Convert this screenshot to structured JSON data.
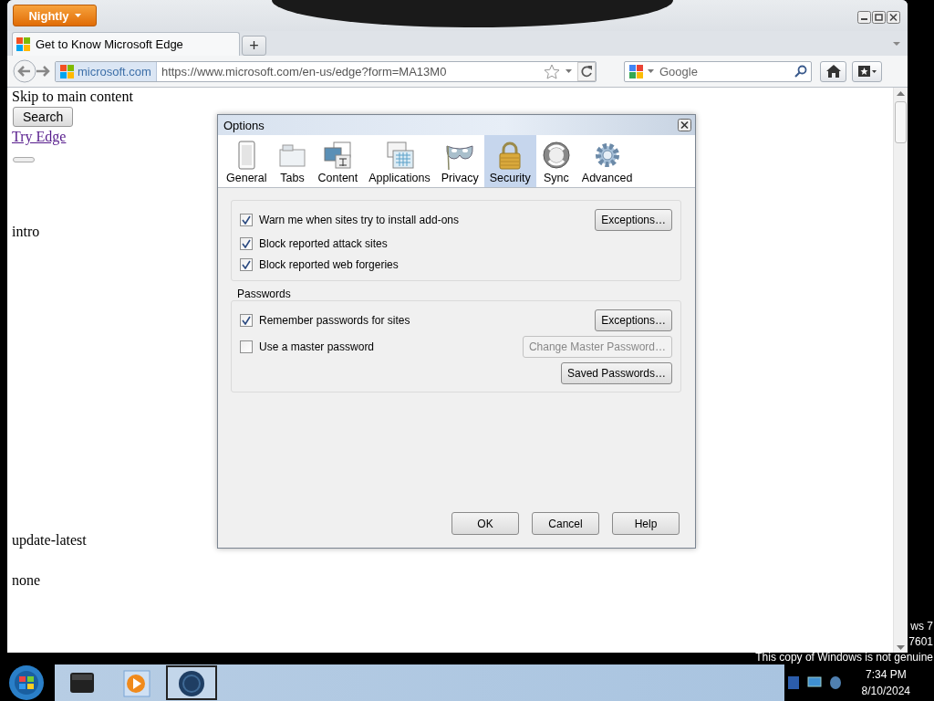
{
  "app_button": {
    "label": "Nightly"
  },
  "tabs": [
    {
      "title": "Get to Know Microsoft Edge",
      "selected": true
    }
  ],
  "new_tab_button": {
    "label": "+"
  },
  "url_bar": {
    "site_identity": "microsoft.com",
    "url": "https://www.microsoft.com/en-us/edge?form=MA13M0"
  },
  "search_bar": {
    "placeholder": "Google"
  },
  "page": {
    "items": [
      {
        "kind": "text",
        "text": "Skip to main content"
      },
      {
        "kind": "button",
        "text": "Search"
      },
      {
        "kind": "link",
        "text": "Try Edge"
      },
      {
        "kind": "slider"
      },
      {
        "kind": "text",
        "text": "intro"
      },
      {
        "kind": "text",
        "text": "update-latest"
      },
      {
        "kind": "text",
        "text": "none"
      }
    ]
  },
  "dialog": {
    "title": "Options",
    "panes": [
      {
        "label": "General",
        "selected": false
      },
      {
        "label": "Tabs",
        "selected": false
      },
      {
        "label": "Content",
        "selected": false
      },
      {
        "label": "Applications",
        "selected": false
      },
      {
        "label": "Privacy",
        "selected": false
      },
      {
        "label": "Security",
        "selected": true
      },
      {
        "label": "Sync",
        "selected": false
      },
      {
        "label": "Advanced",
        "selected": false
      }
    ],
    "groups": [
      {
        "rows": [
          {
            "kind": "checkbox",
            "label": "Warn me when sites try to install add-ons",
            "checked": true,
            "button": {
              "label": "Exceptions…",
              "disabled": false
            }
          },
          {
            "kind": "checkbox",
            "label": "Block reported attack sites",
            "checked": true
          },
          {
            "kind": "checkbox",
            "label": "Block reported web forgeries",
            "checked": true
          }
        ]
      },
      {
        "caption": "Passwords",
        "rows": [
          {
            "kind": "checkbox",
            "label": "Remember passwords for sites",
            "checked": true,
            "button": {
              "label": "Exceptions…",
              "disabled": false
            }
          },
          {
            "kind": "checkbox",
            "label": "Use a master password",
            "checked": false,
            "button": {
              "label": "Change Master Password…",
              "disabled": true
            }
          },
          {
            "kind": "button_row",
            "button": {
              "label": "Saved Passwords…",
              "disabled": false
            }
          }
        ]
      }
    ],
    "buttons": [
      "OK",
      "Cancel",
      "Help"
    ]
  },
  "desktop_notice": [
    "ws 7",
    "7601",
    "This copy of Windows is not genuine"
  ],
  "taskbar": {
    "items": [
      {
        "selected": false
      },
      {
        "selected": false
      },
      {
        "selected": true
      }
    ],
    "clock": {
      "time": "7:34 PM",
      "date": "8/10/2024"
    }
  }
}
